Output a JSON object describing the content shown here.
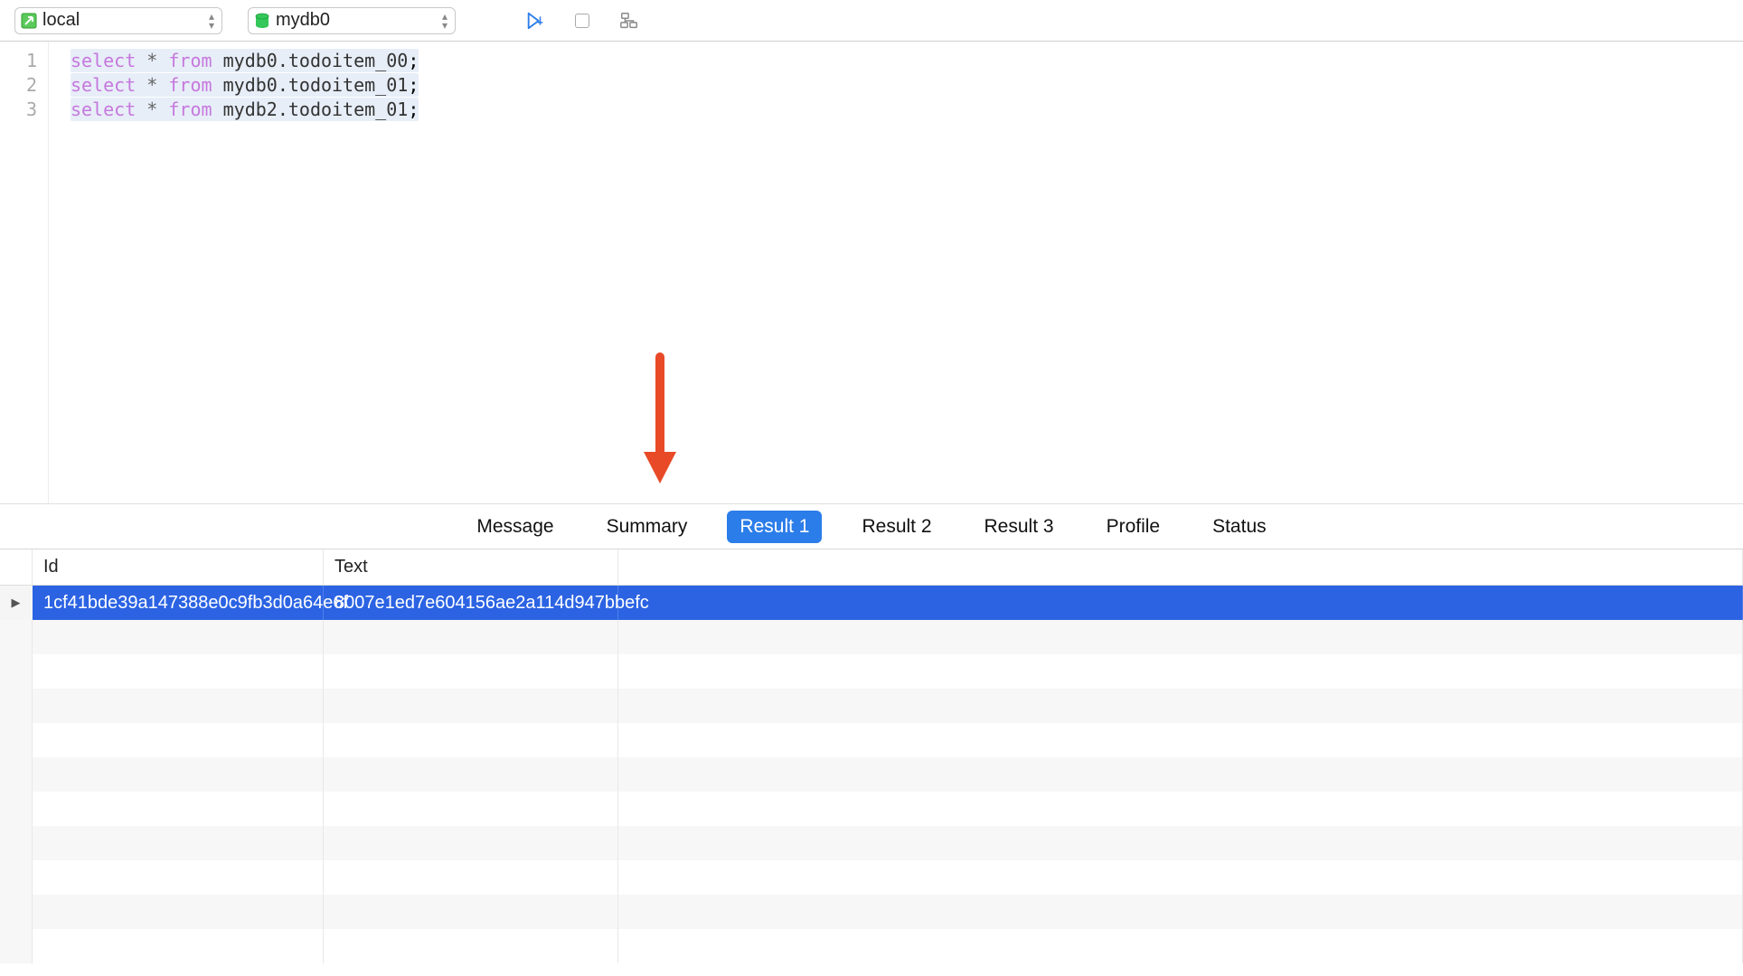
{
  "toolbar": {
    "connection_label": "local",
    "database_label": "mydb0"
  },
  "editor": {
    "lines": [
      {
        "num": "1",
        "kw1": "select",
        "op": "*",
        "kw2": "from",
        "ident": "mydb0.todoitem_00",
        "term": ";"
      },
      {
        "num": "2",
        "kw1": "select",
        "op": "*",
        "kw2": "from",
        "ident": "mydb0.todoitem_01",
        "term": ";"
      },
      {
        "num": "3",
        "kw1": "select",
        "op": "*",
        "kw2": "from",
        "ident": "mydb2.todoitem_01",
        "term": ";"
      }
    ]
  },
  "tabs": [
    {
      "label": "Message",
      "active": false
    },
    {
      "label": "Summary",
      "active": false
    },
    {
      "label": "Result 1",
      "active": true
    },
    {
      "label": "Result 2",
      "active": false
    },
    {
      "label": "Result 3",
      "active": false
    },
    {
      "label": "Profile",
      "active": false
    },
    {
      "label": "Status",
      "active": false
    }
  ],
  "grid": {
    "columns": {
      "id": "Id",
      "text": "Text"
    },
    "rows": [
      {
        "id": "1cf41bde39a147388e0c9fb3d0a64e6f",
        "text": "8007e1ed7e604156ae2a114d947bbefc"
      }
    ]
  },
  "annotation": {
    "arrow_color": "#e84a27"
  }
}
